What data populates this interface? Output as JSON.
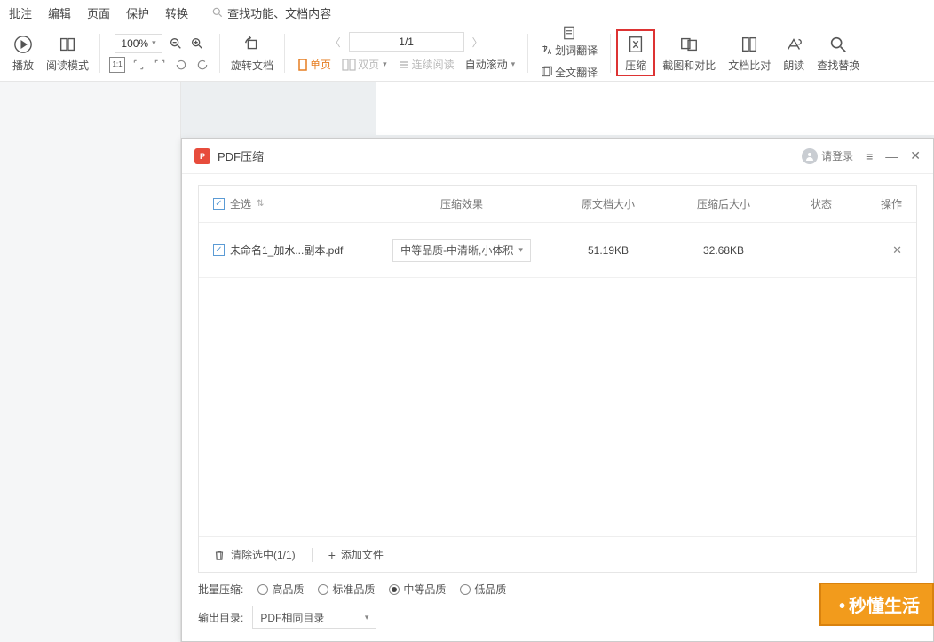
{
  "menubar": {
    "items": [
      "批注",
      "编辑",
      "页面",
      "保护",
      "转换"
    ],
    "search_placeholder": "查找功能、文档内容"
  },
  "toolbar": {
    "play": "播放",
    "read_mode": "阅读模式",
    "zoom": "100%",
    "rotate": "旋转文档",
    "single_page": "单页",
    "double_page": "双页",
    "continuous": "连续阅读",
    "auto_scroll": "自动滚动",
    "page_label": "1/1",
    "word_translate": "划词翻译",
    "full_translate": "全文翻译",
    "compress": "压缩",
    "screenshot_compare": "截图和对比",
    "doc_compare": "文档比对",
    "read_aloud": "朗读",
    "find_replace": "查找替换"
  },
  "dialog": {
    "title": "PDF压缩",
    "login": "请登录",
    "columns": {
      "select_all": "全选",
      "effect": "压缩效果",
      "orig_size": "原文档大小",
      "after_size": "压缩后大小",
      "status": "状态",
      "operation": "操作"
    },
    "row": {
      "name": "未命名1_加水...副本.pdf",
      "effect": "中等品质-中清晰,小体积",
      "orig": "51.19KB",
      "after": "32.68KB"
    },
    "footer": {
      "clear": "清除选中(1/1)",
      "add_file": "添加文件"
    },
    "batch_label": "批量压缩:",
    "quality": {
      "high": "高品质",
      "standard": "标准品质",
      "medium": "中等品质",
      "low": "低品质"
    },
    "output_label": "输出目录:",
    "output_value": "PDF相同目录"
  },
  "watermark": "秒懂生活"
}
